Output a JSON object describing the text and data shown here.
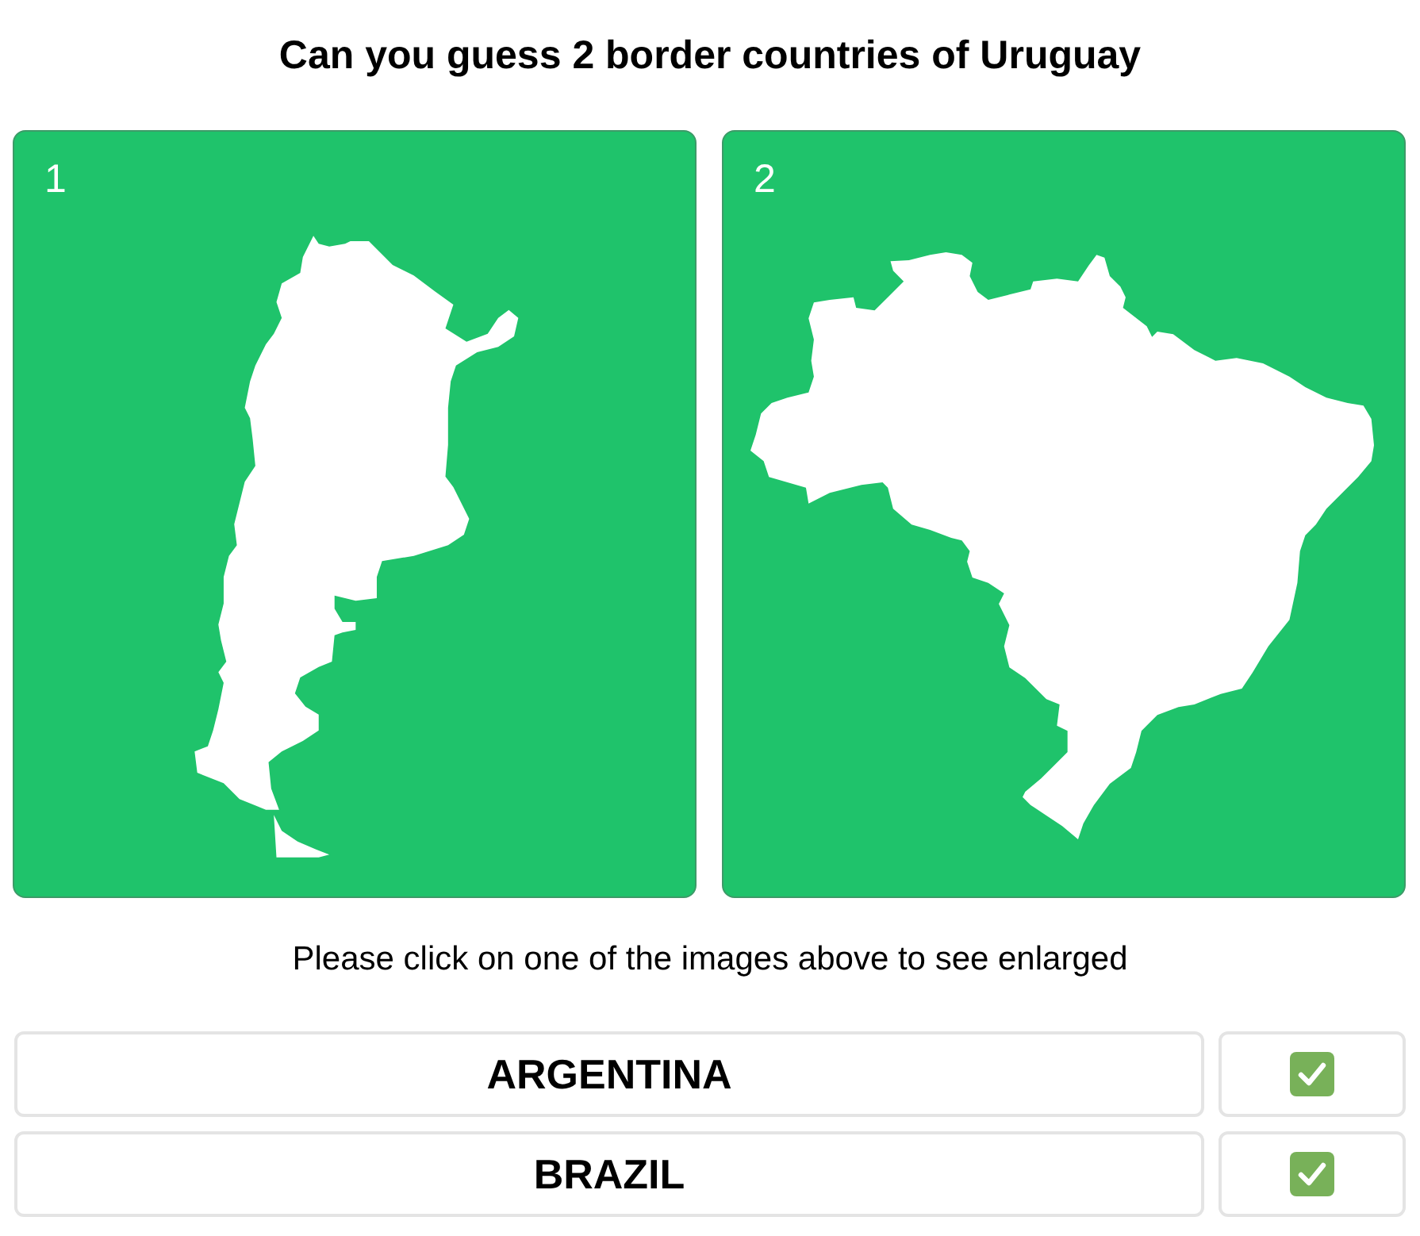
{
  "title": "Can you guess 2 border countries of Uruguay",
  "images": [
    {
      "number": "1"
    },
    {
      "number": "2"
    }
  ],
  "instruction": "Please click on one of the images above to see enlarged",
  "answers": [
    {
      "text": "ARGENTINA",
      "checked": true
    },
    {
      "text": "BRAZIL",
      "checked": true
    }
  ]
}
